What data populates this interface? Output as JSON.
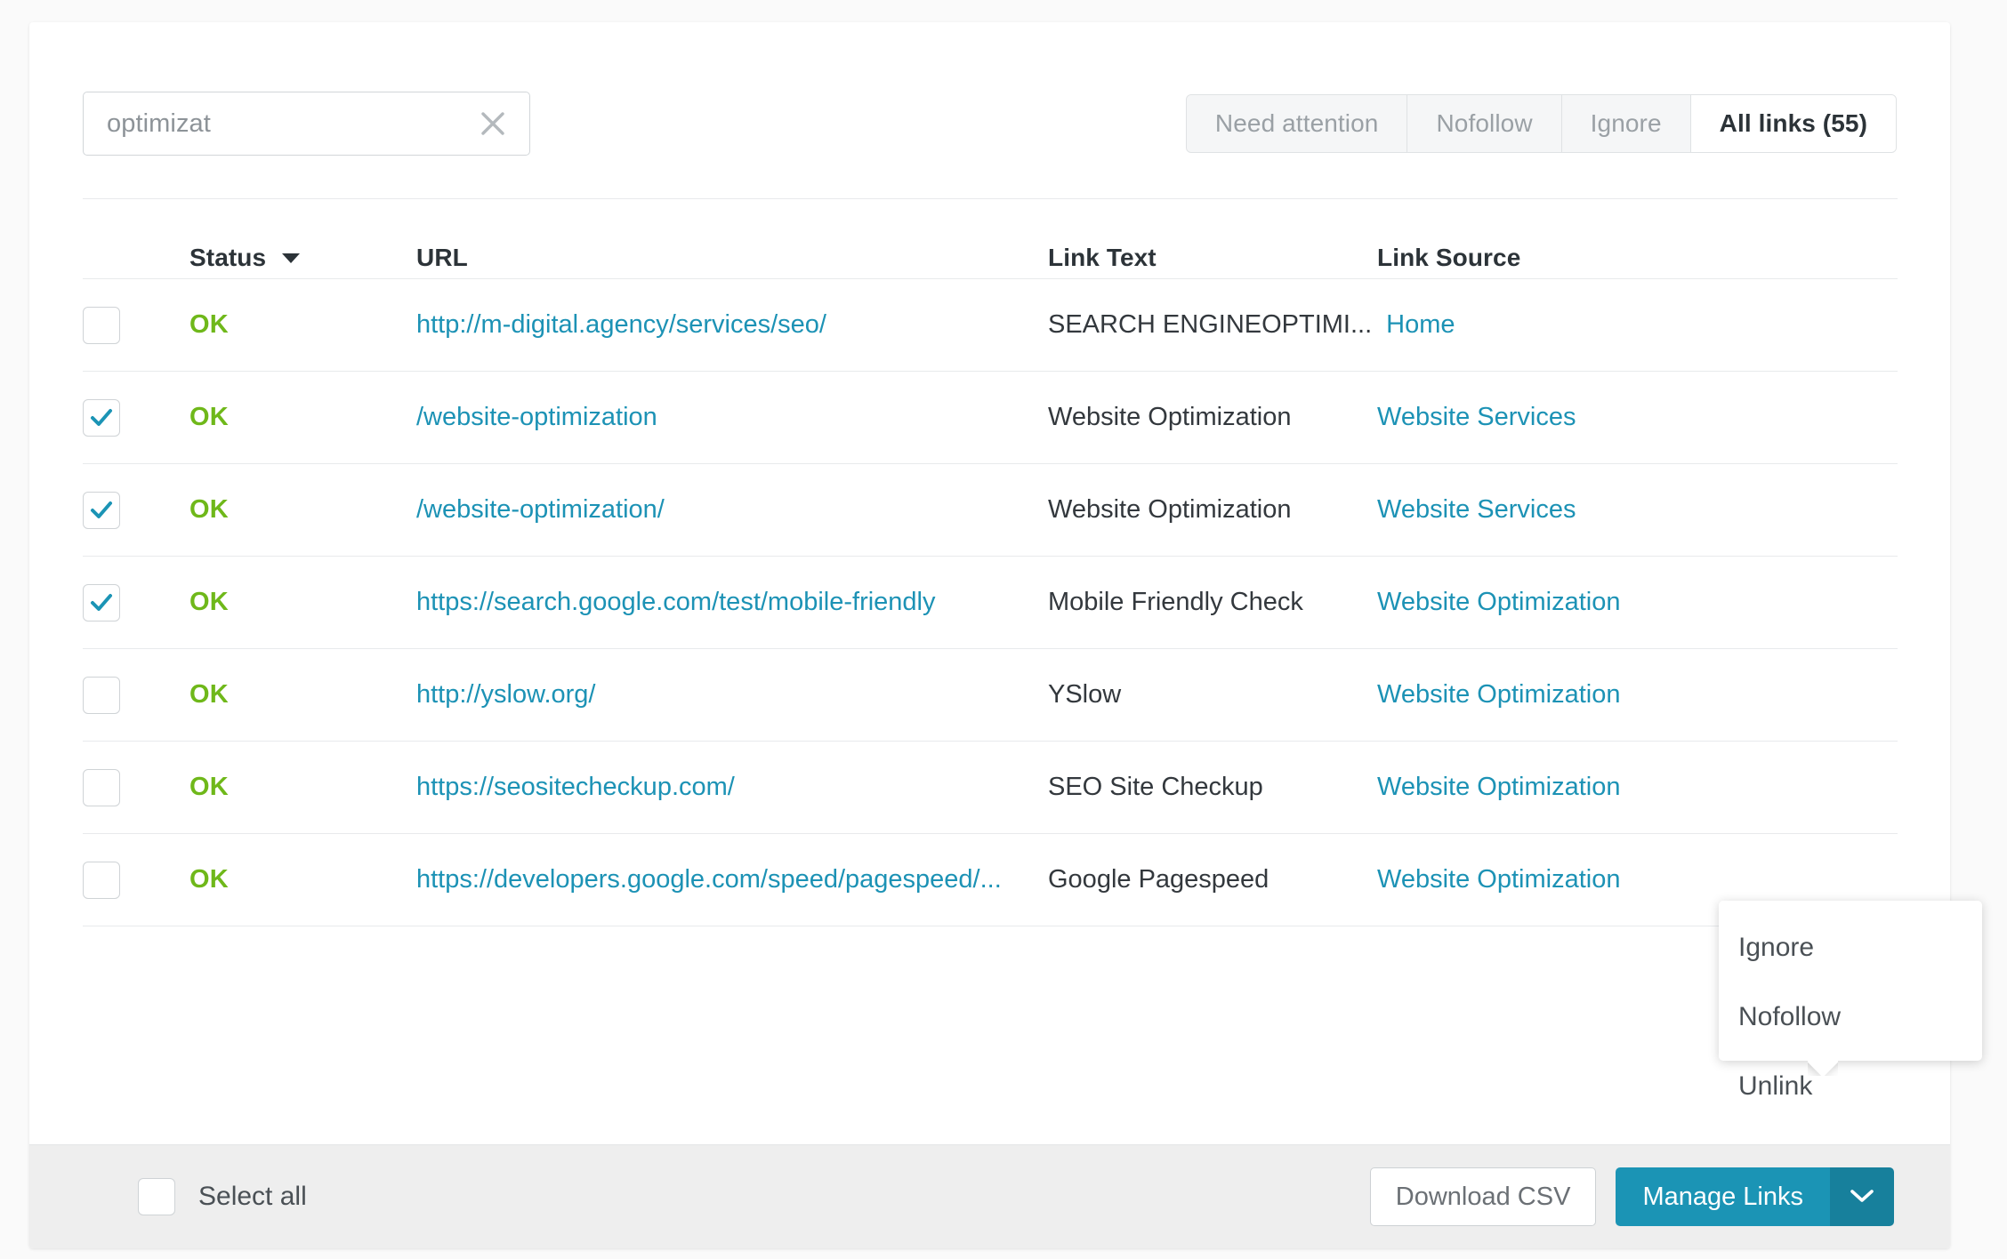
{
  "search": {
    "value": "optimizat",
    "placeholder": "Search",
    "clear_icon": "close-icon"
  },
  "tabs": [
    {
      "label": "Need attention",
      "active": false
    },
    {
      "label": "Nofollow",
      "active": false
    },
    {
      "label": "Ignore",
      "active": false
    },
    {
      "label": "All links (55)",
      "active": true
    }
  ],
  "table": {
    "columns": {
      "status": "Status",
      "url": "URL",
      "link_text": "Link Text",
      "link_source": "Link Source"
    },
    "sort_icon": "sort-descending-icon",
    "rows": [
      {
        "checked": false,
        "status": "OK",
        "url": "http://m-digital.agency/services/seo/",
        "link_text": "SEARCH ENGINEOPTIMI...",
        "link_source": "Home"
      },
      {
        "checked": true,
        "status": "OK",
        "url": "/website-optimization",
        "link_text": "Website Optimization",
        "link_source": "Website Services"
      },
      {
        "checked": true,
        "status": "OK",
        "url": "/website-optimization/",
        "link_text": "Website Optimization",
        "link_source": "Website Services"
      },
      {
        "checked": true,
        "status": "OK",
        "url": "https://search.google.com/test/mobile-friendly",
        "link_text": "Mobile Friendly Check",
        "link_source": "Website Optimization"
      },
      {
        "checked": false,
        "status": "OK",
        "url": "http://yslow.org/",
        "link_text": "YSlow",
        "link_source": "Website Optimization"
      },
      {
        "checked": false,
        "status": "OK",
        "url": "https://seositecheckup.com/",
        "link_text": "SEO Site Checkup",
        "link_source": "Website Optimization"
      },
      {
        "checked": false,
        "status": "OK",
        "url": "https://developers.google.com/speed/pagespeed/...",
        "link_text": "Google Pagespeed",
        "link_source": "Website Optimization"
      }
    ]
  },
  "popover": {
    "items": [
      {
        "label": "Ignore"
      },
      {
        "label": "Nofollow"
      },
      {
        "label": "Unlink"
      }
    ]
  },
  "footer": {
    "select_all_label": "Select all",
    "select_all_checked": false,
    "download_csv_label": "Download CSV",
    "manage_links_label": "Manage Links",
    "caret_icon": "chevron-down-icon"
  },
  "colors": {
    "accent": "#1b94b5",
    "accent_dark": "#17809c",
    "link": "#1c92b5",
    "status_ok": "#6fb81a",
    "footer_bg": "#eeeeee",
    "page_bg": "#fafafa"
  }
}
